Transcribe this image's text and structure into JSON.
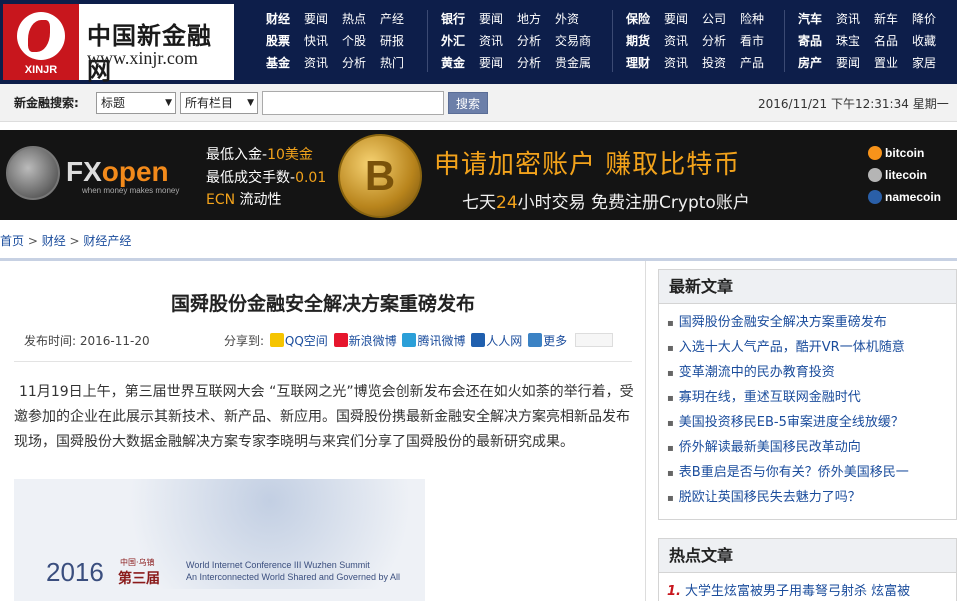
{
  "logo": {
    "brand_cn": "中国新金融网",
    "url": "www.xinjr.com",
    "badge": "XINJR"
  },
  "nav": [
    {
      "rows": [
        [
          "财经",
          "要闻",
          "热点",
          "产经"
        ],
        [
          "股票",
          "快讯",
          "个股",
          "研报"
        ],
        [
          "基金",
          "资讯",
          "分析",
          "热门"
        ]
      ]
    },
    {
      "rows": [
        [
          "银行",
          "要闻",
          "地方",
          "外资"
        ],
        [
          "外汇",
          "资讯",
          "分析",
          "交易商"
        ],
        [
          "黄金",
          "要闻",
          "分析",
          "贵金属"
        ]
      ]
    },
    {
      "rows": [
        [
          "保险",
          "要闻",
          "公司",
          "险种"
        ],
        [
          "期货",
          "资讯",
          "分析",
          "看市"
        ],
        [
          "理财",
          "资讯",
          "投资",
          "产品"
        ]
      ]
    },
    {
      "rows": [
        [
          "汽车",
          "资讯",
          "新车",
          "降价"
        ],
        [
          "寄品",
          "珠宝",
          "名品",
          "收藏"
        ],
        [
          "房产",
          "要闻",
          "置业",
          "家居"
        ]
      ]
    }
  ],
  "search": {
    "label": "新金融搜索:",
    "select1": "标题",
    "select2": "所有栏目",
    "input_value": "",
    "button": "搜索",
    "datetime": "2016/11/21 下午12:31:34 星期一"
  },
  "ad": {
    "line1a": "最低入金-",
    "line1b": "10美金",
    "line2a": "最低成交手数-",
    "line2b": "0.01",
    "line3a": "ECN",
    "line3b": " 流动性",
    "fx_a": "FX",
    "fx_b": "open",
    "fx_sub": "when money makes money",
    "coin": "B",
    "headline": "申请加密账户   赚取比特币",
    "sub_a": "七天",
    "sub_b": "24",
    "sub_c": "小时交易    免费注册Crypto账户",
    "currencies": [
      "bitcoin",
      "litecoin",
      "namecoin"
    ],
    "colors": {
      "bitcoin": "#f7931a",
      "litecoin": "#b5b5b5",
      "namecoin": "#2a5fa8"
    }
  },
  "breadcrumb": {
    "home": "首页",
    "sep": " > ",
    "c1": "财经",
    "c2": "财经产经"
  },
  "article": {
    "title": "国舜股份金融安全解决方案重磅发布",
    "meta": "发布时间: 2016-11-20",
    "share_label": "分享到:",
    "share": [
      "QQ空间",
      "新浪微博",
      "腾讯微博",
      "人人网",
      "更多"
    ],
    "body": "11月19日上午，第三届世界互联网大会 “互联网之光”博览会创新发布会还在如火如荼的举行着，受邀参加的企业在此展示其新技术、新产品、新应用。国舜股份携最新金融安全解决方案亮相新品发布现场，国舜股份大数据金融解决方案专家李晓明与来宾们分享了国舜股份的最新研究成果。",
    "image": {
      "year": "2016",
      "zh_small": "中国·乌镇",
      "zh_big": "第三届",
      "en1": "World Internet Conference III Wuzhen Summit",
      "en2": "An Interconnected World Shared and Governed by All"
    }
  },
  "sidebar": {
    "latest_title": "最新文章",
    "latest": [
      "国舜股份金融安全解决方案重磅发布",
      "入选十大人气产品，酷开VR一体机随意",
      "变革潮流中的民办教育投资",
      "寡玥在线，重述互联网金融时代",
      "美国投资移民EB-5审案进度全线放缓？",
      "侨外解读最新美国移民改革动向",
      "表B重启是否与你有关？侨外美国移民一",
      "脱欧让英国移民失去魅力了吗？"
    ],
    "hot_title": "热点文章",
    "hot": [
      {
        "num": "1.",
        "text": "大学生炫富被男子用毒弩弓射杀 炫富被"
      }
    ]
  }
}
